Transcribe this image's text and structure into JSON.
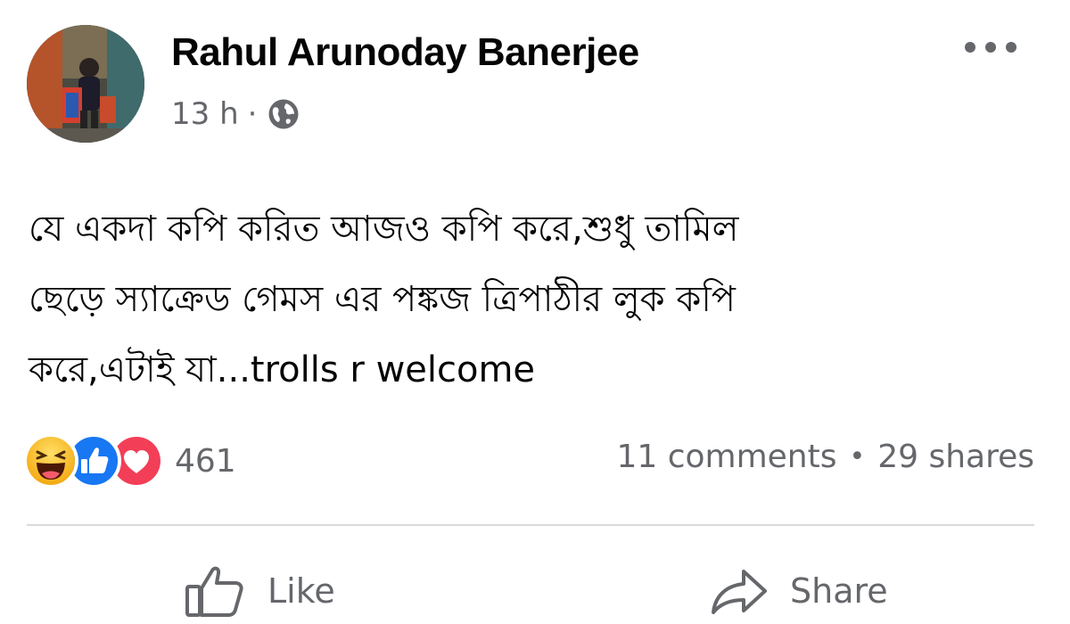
{
  "post": {
    "author": "Rahul Arunoday Banerjee",
    "time": "13 h",
    "separator": "·",
    "privacy_icon": "globe-icon",
    "menu_icon": "more-icon",
    "text_lines": [
      "যে একদা কপি করিত আজও কপি করে,শুধু তামিল",
      "ছেড়ে স্যাক্রেড গেমস এর পঙ্কজ ত্রিপাঠীর লুক কপি",
      "করে,এটাই যা...trolls r welcome"
    ]
  },
  "reactions": {
    "icons": [
      "haha-icon",
      "like-icon",
      "love-icon"
    ],
    "count": "461",
    "colors": {
      "like": "#1877f2",
      "love": "#f33e58",
      "haha": "#f7b125"
    }
  },
  "stats": {
    "comments": "11 comments",
    "dot": "•",
    "shares": "29 shares"
  },
  "actions": {
    "like_label": "Like",
    "share_label": "Share"
  }
}
